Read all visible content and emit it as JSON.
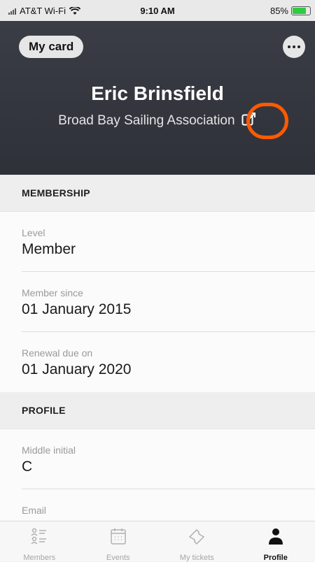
{
  "status_bar": {
    "carrier": "AT&T Wi-Fi",
    "time": "9:10 AM",
    "battery_percent": "85%",
    "battery_level": 0.85
  },
  "header": {
    "my_card_label": "My card",
    "name": "Eric Brinsfield",
    "organization": "Broad Bay Sailing Association",
    "highlight_color": "#ff5a00"
  },
  "membership": {
    "section_title": "MEMBERSHIP",
    "rows": [
      {
        "label": "Level",
        "value": "Member"
      },
      {
        "label": "Member since",
        "value": "01 January 2015"
      },
      {
        "label": "Renewal due on",
        "value": "01 January 2020"
      }
    ]
  },
  "profile": {
    "section_title": "PROFILE",
    "rows": [
      {
        "label": "Middle initial",
        "value": "C"
      },
      {
        "label": "Email",
        "value": ""
      }
    ]
  },
  "tabs": [
    {
      "label": "Members",
      "icon": "members-icon",
      "active": false
    },
    {
      "label": "Events",
      "icon": "calendar-icon",
      "active": false
    },
    {
      "label": "My tickets",
      "icon": "ticket-icon",
      "active": false
    },
    {
      "label": "Profile",
      "icon": "profile-icon",
      "active": true
    }
  ]
}
